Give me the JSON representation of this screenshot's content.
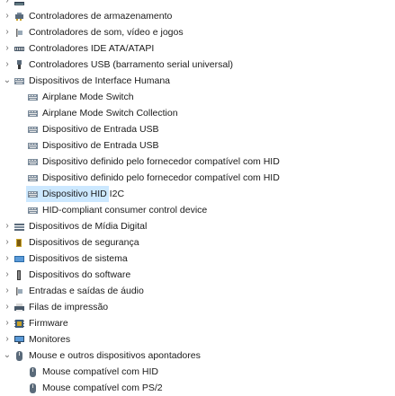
{
  "tree": {
    "items": [
      {
        "label": "",
        "level": 1,
        "expander": "collapsed",
        "icon": "device-icon"
      },
      {
        "label": "Controladores de armazenamento",
        "level": 1,
        "expander": "collapsed",
        "icon": "storage-controller-icon"
      },
      {
        "label": "Controladores de som, vídeo e jogos",
        "level": 1,
        "expander": "collapsed",
        "icon": "sound-icon"
      },
      {
        "label": "Controladores IDE ATA/ATAPI",
        "level": 1,
        "expander": "collapsed",
        "icon": "ide-controller-icon"
      },
      {
        "label": "Controladores USB (barramento serial universal)",
        "level": 1,
        "expander": "collapsed",
        "icon": "usb-icon"
      },
      {
        "label": "Dispositivos de Interface Humana",
        "level": 1,
        "expander": "expanded",
        "icon": "hid-icon"
      },
      {
        "label": "Airplane Mode Switch",
        "level": 2,
        "icon": "hid-icon"
      },
      {
        "label": "Airplane Mode Switch Collection",
        "level": 2,
        "icon": "hid-icon"
      },
      {
        "label": "Dispositivo de Entrada USB",
        "level": 2,
        "icon": "hid-icon"
      },
      {
        "label": "Dispositivo de Entrada USB",
        "level": 2,
        "icon": "hid-icon"
      },
      {
        "label": "Dispositivo definido pelo fornecedor compatível com HID",
        "level": 2,
        "icon": "hid-icon"
      },
      {
        "label": "Dispositivo definido pelo fornecedor compatível com HID",
        "level": 2,
        "icon": "hid-icon"
      },
      {
        "label": "Dispositivo HID I2C",
        "level": 2,
        "icon": "hid-icon",
        "selected": true
      },
      {
        "label": "HID-compliant consumer control device",
        "level": 2,
        "icon": "hid-icon"
      },
      {
        "label": "Dispositivos de Mídia Digital",
        "level": 1,
        "expander": "collapsed",
        "icon": "media-device-icon"
      },
      {
        "label": "Dispositivos de segurança",
        "level": 1,
        "expander": "collapsed",
        "icon": "security-device-icon"
      },
      {
        "label": "Dispositivos de sistema",
        "level": 1,
        "expander": "collapsed",
        "icon": "system-device-icon"
      },
      {
        "label": "Dispositivos do software",
        "level": 1,
        "expander": "collapsed",
        "icon": "software-device-icon"
      },
      {
        "label": "Entradas e saídas de áudio",
        "level": 1,
        "expander": "collapsed",
        "icon": "audio-io-icon"
      },
      {
        "label": "Filas de impressão",
        "level": 1,
        "expander": "collapsed",
        "icon": "print-queue-icon"
      },
      {
        "label": "Firmware",
        "level": 1,
        "expander": "collapsed",
        "icon": "firmware-icon"
      },
      {
        "label": "Monitores",
        "level": 1,
        "expander": "collapsed",
        "icon": "monitor-icon"
      },
      {
        "label": "Mouse e outros dispositivos apontadores",
        "level": 1,
        "expander": "expanded",
        "icon": "mouse-icon"
      },
      {
        "label": "Mouse compatível com HID",
        "level": 2,
        "icon": "mouse-icon"
      },
      {
        "label": "Mouse compatível com PS/2",
        "level": 2,
        "icon": "mouse-icon"
      }
    ]
  },
  "colors": {
    "selection": "#cce8ff",
    "expander": "#6b6b6b",
    "text": "#1a1a1a"
  }
}
